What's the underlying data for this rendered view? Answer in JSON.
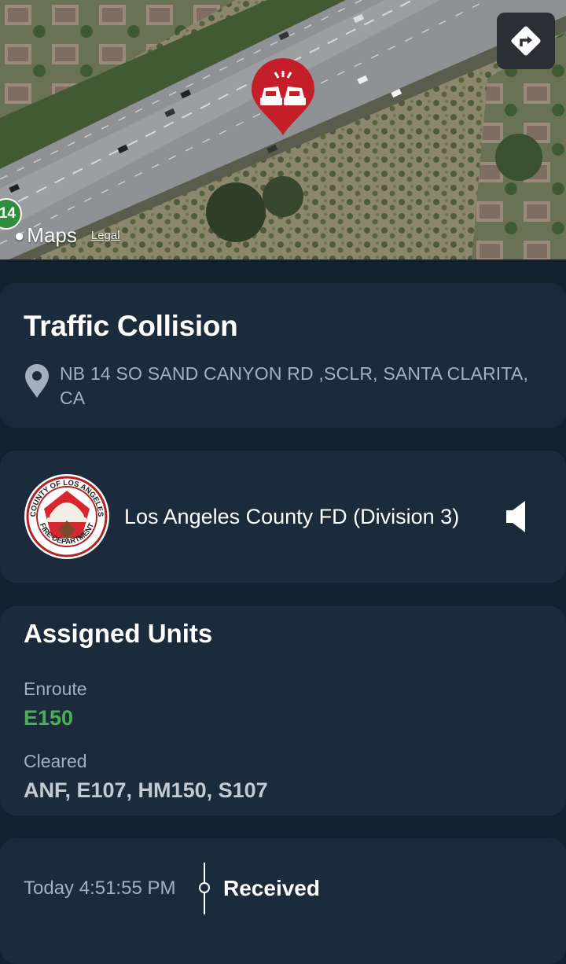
{
  "map": {
    "attribution": "Maps",
    "legal": "Legal",
    "route_shield": "14",
    "pin_icon": "car-collision-icon",
    "directions_icon": "directions-icon"
  },
  "incident": {
    "title": "Traffic Collision",
    "address": "NB 14 SO SAND CANYON RD ,SCLR, SANTA CLARITA, CA",
    "location_icon": "location-pin-icon"
  },
  "agency": {
    "name": "Los Angeles County FD (Division 3)",
    "logo_text_top": "COUNTY OF LOS ANGELES",
    "logo_text_bottom": "FIRE DEPARTMENT",
    "audio_icon": "speaker-icon"
  },
  "units": {
    "title": "Assigned Units",
    "enroute_label": "Enroute",
    "enroute_value": "E150",
    "cleared_label": "Cleared",
    "cleared_value": "ANF, E107, HM150, S107"
  },
  "timeline": [
    {
      "time": "Today 4:51:55 PM",
      "status": "Received"
    }
  ],
  "colors": {
    "background": "#14212e",
    "card": "#1c2b3b",
    "enroute_green": "#47b153",
    "pin_red": "#c41e2a"
  }
}
